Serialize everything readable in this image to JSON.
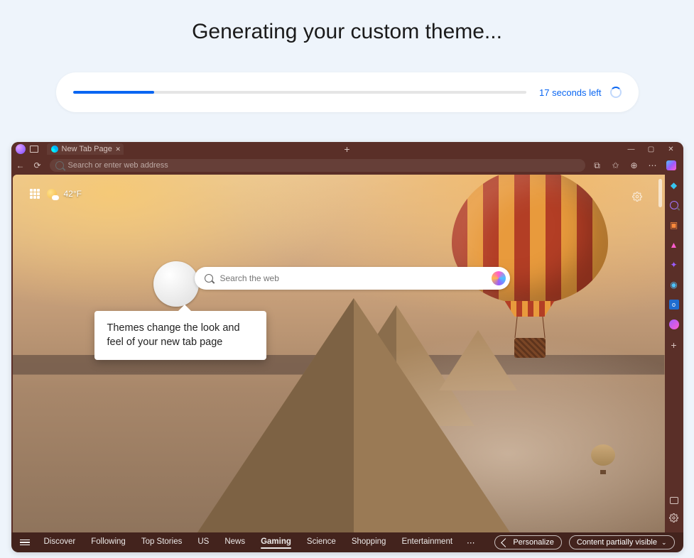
{
  "heading": "Generating your custom theme...",
  "progress": {
    "percent": 18,
    "label": "17 seconds left"
  },
  "browser": {
    "tab_title": "New Tab Page",
    "address_placeholder": "Search or enter web address",
    "theme_color": "#5a2f28"
  },
  "newtab": {
    "temperature": "42°F",
    "search_placeholder": "Search the web",
    "tooltip_text": "Themes change the look and feel of your new tab page"
  },
  "feed": {
    "tabs": [
      "Discover",
      "Following",
      "Top Stories",
      "US",
      "News",
      "Gaming",
      "Science",
      "Shopping",
      "Entertainment"
    ],
    "active_tab": "Gaming",
    "personalize_label": "Personalize",
    "visibility_label": "Content partially visible"
  },
  "sidebar_apps": [
    "chat",
    "search",
    "shopping",
    "games",
    "rewards",
    "people",
    "outlook",
    "messenger"
  ]
}
